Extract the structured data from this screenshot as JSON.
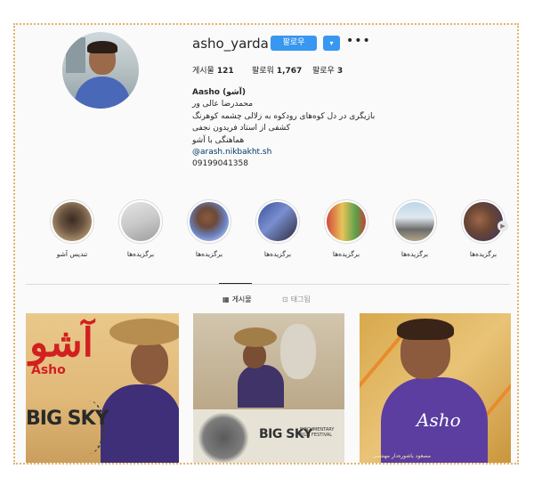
{
  "profile": {
    "username": "asho_yarda",
    "follow_label": "팔로우",
    "dropdown_glyph": "▾",
    "more_glyph": "•••"
  },
  "stats": {
    "posts_label": "게시물",
    "posts_value": "121",
    "followers_label": "팔로워",
    "followers_value": "1,767",
    "following_label": "팔로우",
    "following_value": "3"
  },
  "bio": {
    "name": "Aasho (آشو)",
    "lines": [
      "محمدرضا عالی ور",
      "بازیگری در دل کوه‌های رودکوه به زلالی چشمه کوهرنگ",
      "کشفی از استاد فریدون نجفی",
      "هماهنگی با آشو"
    ],
    "link": "@arash.nikbakht.sh",
    "phone": "09199041358"
  },
  "highlights": [
    {
      "label": "تندیس آشو"
    },
    {
      "label": "برگزیده‌ها"
    },
    {
      "label": "برگزیده‌ها"
    },
    {
      "label": "برگزیده‌ها"
    },
    {
      "label": "برگزیده‌ها"
    },
    {
      "label": "برگزیده‌ها"
    },
    {
      "label": "برگزیده‌ها"
    }
  ],
  "tabs": {
    "posts_label": "게시물",
    "tagged_label": "태그됨"
  },
  "posts": {
    "p1": {
      "title_fa": "آشو",
      "title_en": "Asho",
      "festival": "BIG SKY"
    },
    "p2": {
      "festival": "BIG SKY",
      "festival_sub": "DOCUMENTARY FILM FESTIVAL"
    },
    "p3": {
      "title": "Asho",
      "caption": "مسعود یاشوره‌دار مهنتسی"
    }
  },
  "colors": {
    "accent": "#3897f0",
    "title_red": "#d21f1f",
    "link": "#00376b"
  }
}
